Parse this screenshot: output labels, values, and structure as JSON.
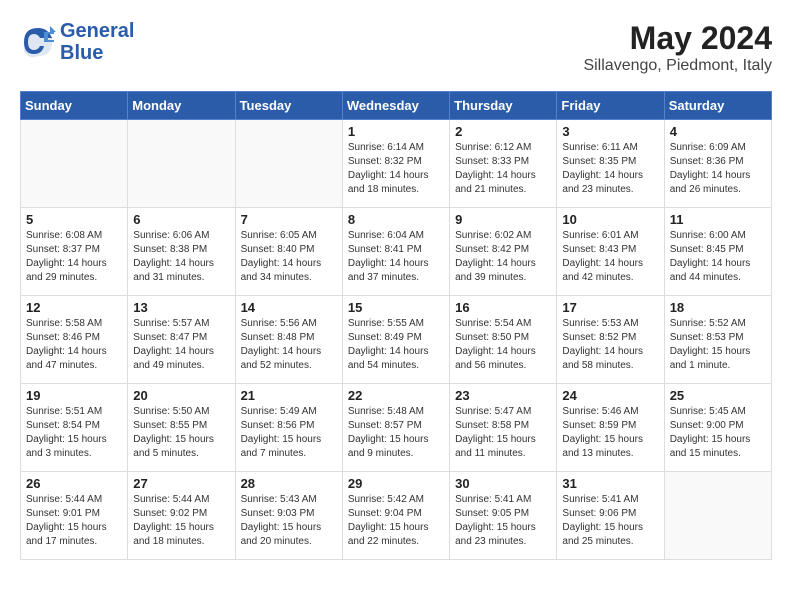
{
  "header": {
    "logo_line1": "General",
    "logo_line2": "Blue",
    "month_year": "May 2024",
    "location": "Sillavengo, Piedmont, Italy"
  },
  "weekdays": [
    "Sunday",
    "Monday",
    "Tuesday",
    "Wednesday",
    "Thursday",
    "Friday",
    "Saturday"
  ],
  "weeks": [
    [
      {
        "day": "",
        "info": ""
      },
      {
        "day": "",
        "info": ""
      },
      {
        "day": "",
        "info": ""
      },
      {
        "day": "1",
        "info": "Sunrise: 6:14 AM\nSunset: 8:32 PM\nDaylight: 14 hours\nand 18 minutes."
      },
      {
        "day": "2",
        "info": "Sunrise: 6:12 AM\nSunset: 8:33 PM\nDaylight: 14 hours\nand 21 minutes."
      },
      {
        "day": "3",
        "info": "Sunrise: 6:11 AM\nSunset: 8:35 PM\nDaylight: 14 hours\nand 23 minutes."
      },
      {
        "day": "4",
        "info": "Sunrise: 6:09 AM\nSunset: 8:36 PM\nDaylight: 14 hours\nand 26 minutes."
      }
    ],
    [
      {
        "day": "5",
        "info": "Sunrise: 6:08 AM\nSunset: 8:37 PM\nDaylight: 14 hours\nand 29 minutes."
      },
      {
        "day": "6",
        "info": "Sunrise: 6:06 AM\nSunset: 8:38 PM\nDaylight: 14 hours\nand 31 minutes."
      },
      {
        "day": "7",
        "info": "Sunrise: 6:05 AM\nSunset: 8:40 PM\nDaylight: 14 hours\nand 34 minutes."
      },
      {
        "day": "8",
        "info": "Sunrise: 6:04 AM\nSunset: 8:41 PM\nDaylight: 14 hours\nand 37 minutes."
      },
      {
        "day": "9",
        "info": "Sunrise: 6:02 AM\nSunset: 8:42 PM\nDaylight: 14 hours\nand 39 minutes."
      },
      {
        "day": "10",
        "info": "Sunrise: 6:01 AM\nSunset: 8:43 PM\nDaylight: 14 hours\nand 42 minutes."
      },
      {
        "day": "11",
        "info": "Sunrise: 6:00 AM\nSunset: 8:45 PM\nDaylight: 14 hours\nand 44 minutes."
      }
    ],
    [
      {
        "day": "12",
        "info": "Sunrise: 5:58 AM\nSunset: 8:46 PM\nDaylight: 14 hours\nand 47 minutes."
      },
      {
        "day": "13",
        "info": "Sunrise: 5:57 AM\nSunset: 8:47 PM\nDaylight: 14 hours\nand 49 minutes."
      },
      {
        "day": "14",
        "info": "Sunrise: 5:56 AM\nSunset: 8:48 PM\nDaylight: 14 hours\nand 52 minutes."
      },
      {
        "day": "15",
        "info": "Sunrise: 5:55 AM\nSunset: 8:49 PM\nDaylight: 14 hours\nand 54 minutes."
      },
      {
        "day": "16",
        "info": "Sunrise: 5:54 AM\nSunset: 8:50 PM\nDaylight: 14 hours\nand 56 minutes."
      },
      {
        "day": "17",
        "info": "Sunrise: 5:53 AM\nSunset: 8:52 PM\nDaylight: 14 hours\nand 58 minutes."
      },
      {
        "day": "18",
        "info": "Sunrise: 5:52 AM\nSunset: 8:53 PM\nDaylight: 15 hours\nand 1 minute."
      }
    ],
    [
      {
        "day": "19",
        "info": "Sunrise: 5:51 AM\nSunset: 8:54 PM\nDaylight: 15 hours\nand 3 minutes."
      },
      {
        "day": "20",
        "info": "Sunrise: 5:50 AM\nSunset: 8:55 PM\nDaylight: 15 hours\nand 5 minutes."
      },
      {
        "day": "21",
        "info": "Sunrise: 5:49 AM\nSunset: 8:56 PM\nDaylight: 15 hours\nand 7 minutes."
      },
      {
        "day": "22",
        "info": "Sunrise: 5:48 AM\nSunset: 8:57 PM\nDaylight: 15 hours\nand 9 minutes."
      },
      {
        "day": "23",
        "info": "Sunrise: 5:47 AM\nSunset: 8:58 PM\nDaylight: 15 hours\nand 11 minutes."
      },
      {
        "day": "24",
        "info": "Sunrise: 5:46 AM\nSunset: 8:59 PM\nDaylight: 15 hours\nand 13 minutes."
      },
      {
        "day": "25",
        "info": "Sunrise: 5:45 AM\nSunset: 9:00 PM\nDaylight: 15 hours\nand 15 minutes."
      }
    ],
    [
      {
        "day": "26",
        "info": "Sunrise: 5:44 AM\nSunset: 9:01 PM\nDaylight: 15 hours\nand 17 minutes."
      },
      {
        "day": "27",
        "info": "Sunrise: 5:44 AM\nSunset: 9:02 PM\nDaylight: 15 hours\nand 18 minutes."
      },
      {
        "day": "28",
        "info": "Sunrise: 5:43 AM\nSunset: 9:03 PM\nDaylight: 15 hours\nand 20 minutes."
      },
      {
        "day": "29",
        "info": "Sunrise: 5:42 AM\nSunset: 9:04 PM\nDaylight: 15 hours\nand 22 minutes."
      },
      {
        "day": "30",
        "info": "Sunrise: 5:41 AM\nSunset: 9:05 PM\nDaylight: 15 hours\nand 23 minutes."
      },
      {
        "day": "31",
        "info": "Sunrise: 5:41 AM\nSunset: 9:06 PM\nDaylight: 15 hours\nand 25 minutes."
      },
      {
        "day": "",
        "info": ""
      }
    ]
  ]
}
